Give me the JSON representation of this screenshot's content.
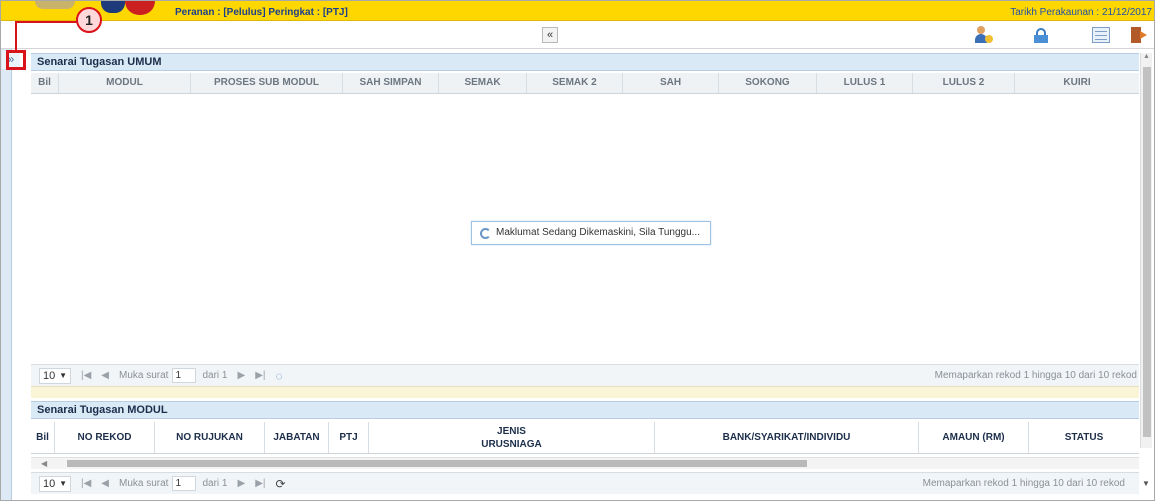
{
  "header": {
    "role_line": "Peranan : [Pelulus] Peringkat : [PTJ]",
    "account_date": "Tarikh Perakaunan : 21/12/2017"
  },
  "toolbar": {
    "collapse_symbol": "«",
    "icons": [
      "user-add-icon",
      "lock-icon",
      "list-view-icon",
      "logout-icon"
    ]
  },
  "sidebar": {
    "expand_symbol": "»"
  },
  "callout": {
    "number": "1",
    "color": "#d8141a"
  },
  "panel_umum": {
    "title": "Senarai Tugasan UMUM",
    "columns": [
      "Bil",
      "MODUL",
      "PROSES SUB MODUL",
      "SAH SIMPAN",
      "SEMAK",
      "SEMAK 2",
      "SAH",
      "SOKONG",
      "LULUS 1",
      "LULUS 2",
      "KUIRI"
    ],
    "loading_message": "Maklumat Sedang Dikemaskini, Sila Tunggu...",
    "pager": {
      "page_size": "10",
      "page_label": "Muka surat",
      "page_value": "1",
      "of_label": "dari 1",
      "info": "Memaparkan rekod 1 hingga 10 dari 10 rekod"
    }
  },
  "panel_modul": {
    "title": "Senarai Tugasan MODUL",
    "columns": [
      "Bil",
      "NO REKOD",
      "NO RUJUKAN",
      "JABATAN",
      "PTJ",
      "JENIS URUSNIAGA",
      "BANK/SYARIKAT/INDIVIDU",
      "AMAUN (RM)",
      "STATUS"
    ],
    "column_jenis_line1": "JENIS",
    "column_jenis_line2": "URUSNIAGA",
    "pager": {
      "page_size": "10",
      "page_label": "Muka surat",
      "page_value": "1",
      "of_label": "dari 1",
      "info": "Memaparkan rekod 1 hingga 10 dari 10 rekod"
    }
  },
  "colors": {
    "top_bar": "#ffd700",
    "panel_header": "#d9e9f6",
    "accent_blue": "#1a3f8c"
  }
}
